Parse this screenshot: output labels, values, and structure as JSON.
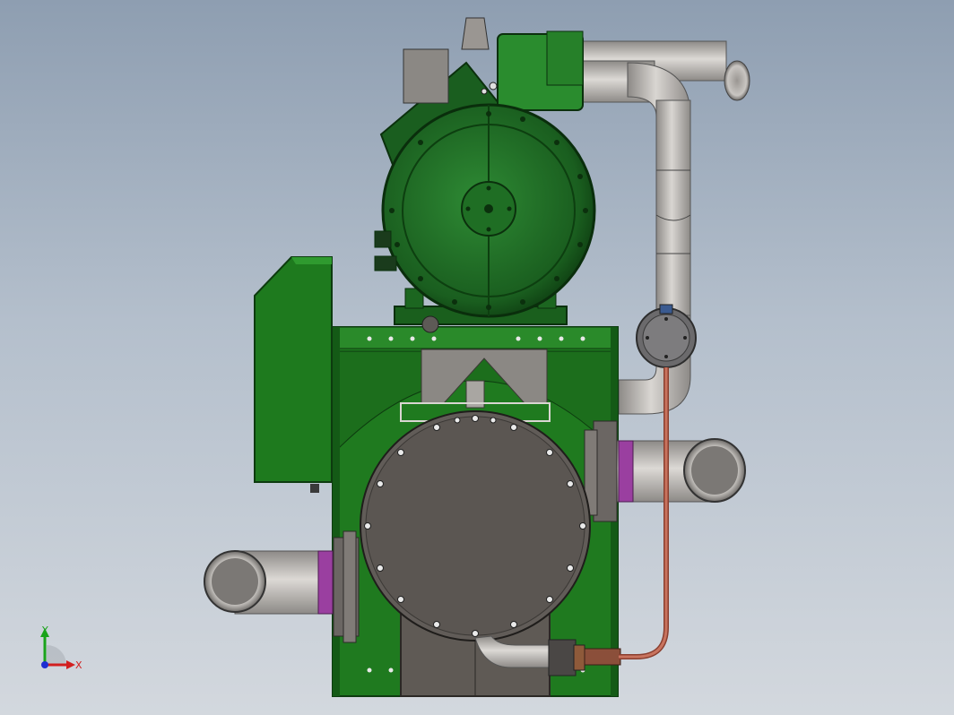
{
  "viewport": {
    "background_top": "#8e9eb1",
    "background_bottom": "#d3d8de"
  },
  "model": {
    "colors": {
      "frame_green": "#1f7a1f",
      "frame_green_dark": "#0f4a12",
      "compressor_green": "#1e6b22",
      "steel_gray": "#5f5a55",
      "pipe_gray": "#b9b6b2",
      "gasket_purple": "#9a3fa0",
      "copper": "#b4634f"
    }
  },
  "triad": {
    "x_label": "X",
    "y_label": "Y",
    "x_color": "#d21f1f",
    "y_color": "#1aa31a",
    "z_color": "#1f2fd2"
  }
}
